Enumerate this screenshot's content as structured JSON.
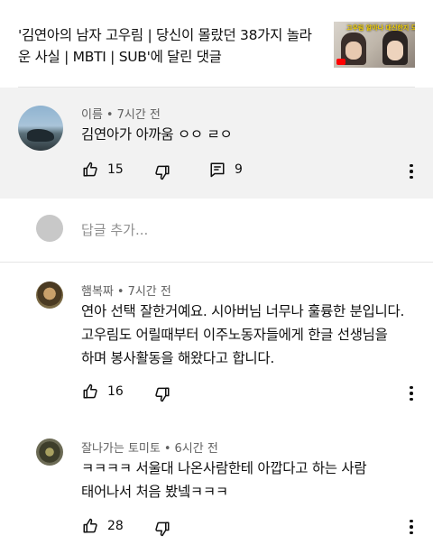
{
  "video": {
    "title": "'김연아의 남자 고우림 | 당신이 몰랐던 38가지 놀라운 사실 | MBTI | SUB'에 달린 댓글",
    "thumbnail_text": "고우림 알아나 대신한지 모두"
  },
  "main_comment": {
    "author": "이름",
    "time": "7시간 전",
    "text": "김연아가 아까움 ㅇㅇ ㄹㅇ",
    "likes": "15",
    "replies": "9"
  },
  "reply_input": {
    "placeholder": "답글 추가..."
  },
  "replies": [
    {
      "author": "햄복짜",
      "time": "7시간 전",
      "lines": [
        "연아 선택 잘한거예요. 시아버님 너무나 훌륭한 분입니다.",
        "고우림도 어릴때부터 이주노동자들에게 한글 선생님을",
        "하며 봉사활동을 해왔다고 합니다."
      ],
      "likes": "16"
    },
    {
      "author": "잘나가는 토미토",
      "time": "6시간 전",
      "lines": [
        "ㅋㅋㅋㅋ 서울대 나온사람한테 아깝다고 하는 사람",
        "태어나서 처음 봤넼ㅋㅋㅋ"
      ],
      "likes": "28"
    }
  ],
  "separator": "•"
}
